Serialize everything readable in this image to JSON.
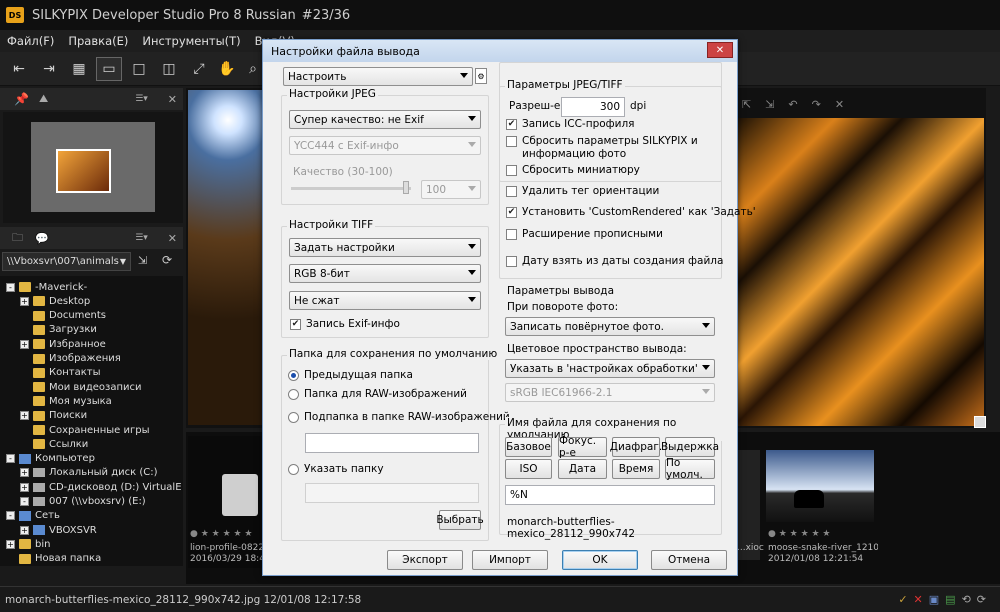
{
  "window": {
    "title": "SILKYPIX Developer Studio Pro 8 Russian",
    "counter": "#23/36",
    "logo": "DS"
  },
  "menu": [
    "Файл(F)",
    "Правка(E)",
    "Инструменты(T)",
    "Вид(V)"
  ],
  "left_panel": {
    "path": "\\\\Vboxsvr\\007\\animals",
    "tree": [
      {
        "label": "-Maverick-",
        "level": 0,
        "icon": "folder",
        "expand": "-"
      },
      {
        "label": "Desktop",
        "level": 1,
        "icon": "folder",
        "expand": "+"
      },
      {
        "label": "Documents",
        "level": 1,
        "icon": "folder",
        "expand": ""
      },
      {
        "label": "Загрузки",
        "level": 1,
        "icon": "folder",
        "expand": ""
      },
      {
        "label": "Избранное",
        "level": 1,
        "icon": "folder",
        "expand": "+"
      },
      {
        "label": "Изображения",
        "level": 1,
        "icon": "folder",
        "expand": ""
      },
      {
        "label": "Контакты",
        "level": 1,
        "icon": "folder",
        "expand": ""
      },
      {
        "label": "Мои видеозаписи",
        "level": 1,
        "icon": "folder",
        "expand": ""
      },
      {
        "label": "Моя музыка",
        "level": 1,
        "icon": "folder",
        "expand": ""
      },
      {
        "label": "Поиски",
        "level": 1,
        "icon": "folder",
        "expand": "+"
      },
      {
        "label": "Сохраненные игры",
        "level": 1,
        "icon": "folder",
        "expand": ""
      },
      {
        "label": "Ссылки",
        "level": 1,
        "icon": "folder",
        "expand": ""
      },
      {
        "label": "Компьютер",
        "level": 0,
        "icon": "pc",
        "expand": "-"
      },
      {
        "label": "Локальный диск (C:)",
        "level": 1,
        "icon": "drive",
        "expand": "+"
      },
      {
        "label": "CD-дисковод (D:) VirtualE",
        "level": 1,
        "icon": "drive",
        "expand": "+"
      },
      {
        "label": "007 (\\\\vboxsrv) (E:)",
        "level": 1,
        "icon": "drive",
        "expand": "-"
      },
      {
        "label": "Сеть",
        "level": 0,
        "icon": "pc",
        "expand": "-"
      },
      {
        "label": "VBOXSVR",
        "level": 1,
        "icon": "pc",
        "expand": "+"
      },
      {
        "label": "bin",
        "level": 0,
        "icon": "folder",
        "expand": "+"
      },
      {
        "label": "Новая папка",
        "level": 0,
        "icon": "folder",
        "expand": ""
      }
    ]
  },
  "filmstrip": [
    {
      "name": "lion-profile-08220...",
      "date": "2016/03/29 18:47:3"
    },
    {
      "name": "...хіос",
      "date": ""
    },
    {
      "name": "moose-snake-river_1210...",
      "date": "2012/01/08 12:21:54"
    }
  ],
  "status": {
    "file": "monarch-butterflies-mexico_28112_990x742.jpg 12/01/08 12:17:58"
  },
  "dialog": {
    "title": "Настройки файла вывода",
    "preset": "Настроить",
    "jpeg": {
      "group": "Настройки JPEG",
      "quality_mode": "Супер качество: не Exif",
      "subsampling": "YCC444 с Exif-инфо",
      "quality_label": "Качество (30-100)",
      "quality_value": "100"
    },
    "tiff": {
      "group": "Настройки TIFF",
      "mode": "Задать настройки",
      "bits": "RGB 8-бит",
      "compression": "Не сжат",
      "exif_label": "Запись Exif-инфо"
    },
    "folder": {
      "group": "Папка для сохранения по умолчанию",
      "options": [
        "Предыдущая папка",
        "Папка для RAW-изображений",
        "Подпапка в папке RAW-изображений",
        "Указать папку"
      ],
      "browse": "Выбрать"
    },
    "jt": {
      "group": "Параметры JPEG/TIFF",
      "res_label": "Разреш-е:",
      "res_value": "300",
      "res_unit": "dpi",
      "checks": [
        {
          "label": "Запись ICC-профиля",
          "on": true
        },
        {
          "label": "Сбросить параметры SILKYPIX и",
          "on": false
        },
        {
          "label": "информацию фото",
          "on": false
        },
        {
          "label": "Сбросить миниатюру",
          "on": false
        },
        {
          "label": "Удалить тег ориентации",
          "on": false
        },
        {
          "label": "Установить 'CustomRendered' как 'Задать'",
          "on": true
        },
        {
          "label": "Расширение прописными",
          "on": false
        },
        {
          "label": "Дату взять из даты создания файла",
          "on": false
        }
      ]
    },
    "output": {
      "group": "Параметры вывода",
      "rotate_label": "При повороте фото:",
      "rotate_value": "Записать повёрнутое фото.",
      "color_label": "Цветовое пространство вывода:",
      "color_value": "Указать в 'настройках обработки'",
      "color_profile": "sRGB IEC61966-2.1"
    },
    "filename": {
      "group": "Имя файла для сохранения по умолчанию",
      "buttons": [
        "Базовое",
        "Фокус. р-е",
        "Диафраг.",
        "Выдержка",
        "ISO",
        "Дата",
        "Время",
        "По умолч."
      ],
      "pattern": "%N",
      "preview": "monarch-butterflies-mexico_28112_990x742"
    },
    "footer": {
      "export": "Экспорт",
      "import": "Импорт",
      "ok": "OK",
      "cancel": "Отмена"
    }
  }
}
